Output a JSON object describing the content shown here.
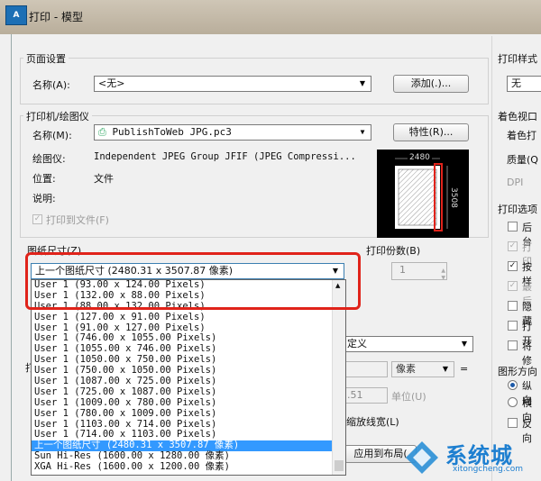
{
  "window": {
    "icon_text": "A",
    "title": "打印 - 模型"
  },
  "page_setup": {
    "group_title": "页面设置",
    "name_label": "名称(A):",
    "name_value": "<无>",
    "add_button": "添加(.)..."
  },
  "printer": {
    "group_title": "打印机/绘图仪",
    "name_label": "名称(M):",
    "name_value": "PublishToWeb JPG.pc3",
    "properties_button": "特性(R)...",
    "plotter_label": "绘图仪:",
    "plotter_value": "Independent JPEG Group JFIF (JPEG Compressi...",
    "location_label": "位置:",
    "location_value": "文件",
    "description_label": "说明:",
    "plot_to_file_label": "打印到文件(F)",
    "preview": {
      "width_label": "2480",
      "height_label": "3508"
    }
  },
  "paper_size": {
    "group_title": "图纸尺寸(Z)",
    "selected": "上一个图纸尺寸 (2480.31 x 3507.87 像素)",
    "options": [
      "User 1 (93.00 x 124.00 Pixels)",
      "User 1 (132.00 x 88.00 Pixels)",
      "User 1 (88.00 x 132.00 Pixels)",
      "User 1 (127.00 x 91.00 Pixels)",
      "User 1 (91.00 x 127.00 Pixels)",
      "User 1 (746.00 x 1055.00 Pixels)",
      "User 1 (1055.00 x 746.00 Pixels)",
      "User 1 (1050.00 x 750.00 Pixels)",
      "User 1 (750.00 x 1050.00 Pixels)",
      "User 1 (1087.00 x 725.00 Pixels)",
      "User 1 (725.00 x 1087.00 Pixels)",
      "User 1 (1009.00 x 780.00 Pixels)",
      "User 1 (780.00 x 1009.00 Pixels)",
      "User 1 (1103.00 x 714.00 Pixels)",
      "User 1 (714.00 x 1103.00 Pixels)",
      "上一个图纸尺寸 (2480.31 x 3507.87 像素)",
      "Sun Hi-Res (1600.00 x 1280.00 像素)",
      "XGA Hi-Res (1600.00 x 1200.00 像素)"
    ],
    "selected_option_index": 15
  },
  "copies": {
    "label": "打印份数(B)",
    "value": "1"
  },
  "partial": {
    "custom_combo": "定义",
    "units_combo": "像素",
    "units_field": ".51",
    "units_label": "单位(U)",
    "scale_lineweights": "缩放线宽(L)",
    "apply_layout_button": "应用到布局(",
    "left_cut": "打",
    "eq_sign": "="
  },
  "right_panel": {
    "plot_style_title": "打印样式",
    "plot_style_value": "无",
    "shaded_title": "着色视口",
    "shade_plot_label": "着色打",
    "quality_label": "质量(Q",
    "dpi_label": "DPI",
    "plot_options_title": "打印选项",
    "options": [
      {
        "label": "后台",
        "checked": false,
        "disabled": false
      },
      {
        "label": "打印",
        "checked": true,
        "disabled": true
      },
      {
        "label": "按样",
        "checked": true,
        "disabled": false
      },
      {
        "label": "最后",
        "checked": true,
        "disabled": true
      },
      {
        "label": "隐藏",
        "checked": false,
        "disabled": false
      },
      {
        "label": "打开",
        "checked": false,
        "disabled": false
      },
      {
        "label": "将修",
        "checked": false,
        "disabled": false
      }
    ],
    "orientation_title": "图形方向",
    "portrait_label": "纵向",
    "landscape_label": "横向",
    "reverse_label": "反向"
  },
  "watermark": {
    "brand": "系统城",
    "url": "xitongcheng.com"
  },
  "accent": {
    "highlight_red": "#e0231a",
    "selection_blue": "#3399ff"
  }
}
